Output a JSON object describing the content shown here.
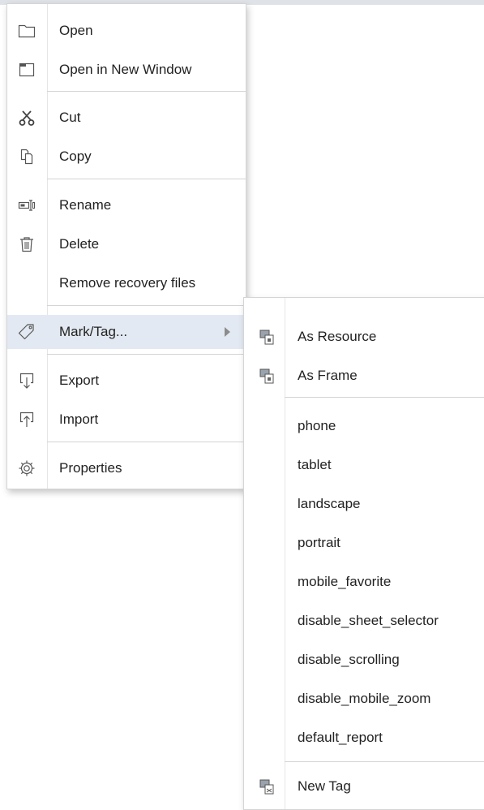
{
  "context_menu": {
    "items": [
      {
        "label": "Open",
        "icon": "folder-icon"
      },
      {
        "label": "Open in New Window",
        "icon": "window-icon"
      },
      {
        "label": "Cut",
        "icon": "scissors-icon"
      },
      {
        "label": "Copy",
        "icon": "copy-icon"
      },
      {
        "label": "Rename",
        "icon": "rename-icon"
      },
      {
        "label": "Delete",
        "icon": "trash-icon"
      },
      {
        "label": "Remove recovery files",
        "icon": ""
      },
      {
        "label": "Mark/Tag...",
        "icon": "tag-icon",
        "has_submenu": true,
        "highlighted": true
      },
      {
        "label": "Export",
        "icon": "export-icon"
      },
      {
        "label": "Import",
        "icon": "import-icon"
      },
      {
        "label": "Properties",
        "icon": "gear-icon"
      }
    ]
  },
  "submenu": {
    "items": [
      {
        "label": "As Resource",
        "icon": "resource-tag-icon"
      },
      {
        "label": "As Frame",
        "icon": "frame-tag-icon"
      },
      {
        "label": "phone"
      },
      {
        "label": "tablet"
      },
      {
        "label": "landscape"
      },
      {
        "label": "portrait"
      },
      {
        "label": "mobile_favorite"
      },
      {
        "label": "disable_sheet_selector"
      },
      {
        "label": "disable_scrolling"
      },
      {
        "label": "disable_mobile_zoom"
      },
      {
        "label": "default_report"
      },
      {
        "label": "New Tag",
        "icon": "new-tag-icon"
      }
    ]
  },
  "colors": {
    "highlight": "#e3e9f2",
    "border": "#d5d5d5",
    "separator": "#d4d4d4",
    "text": "#222222"
  }
}
